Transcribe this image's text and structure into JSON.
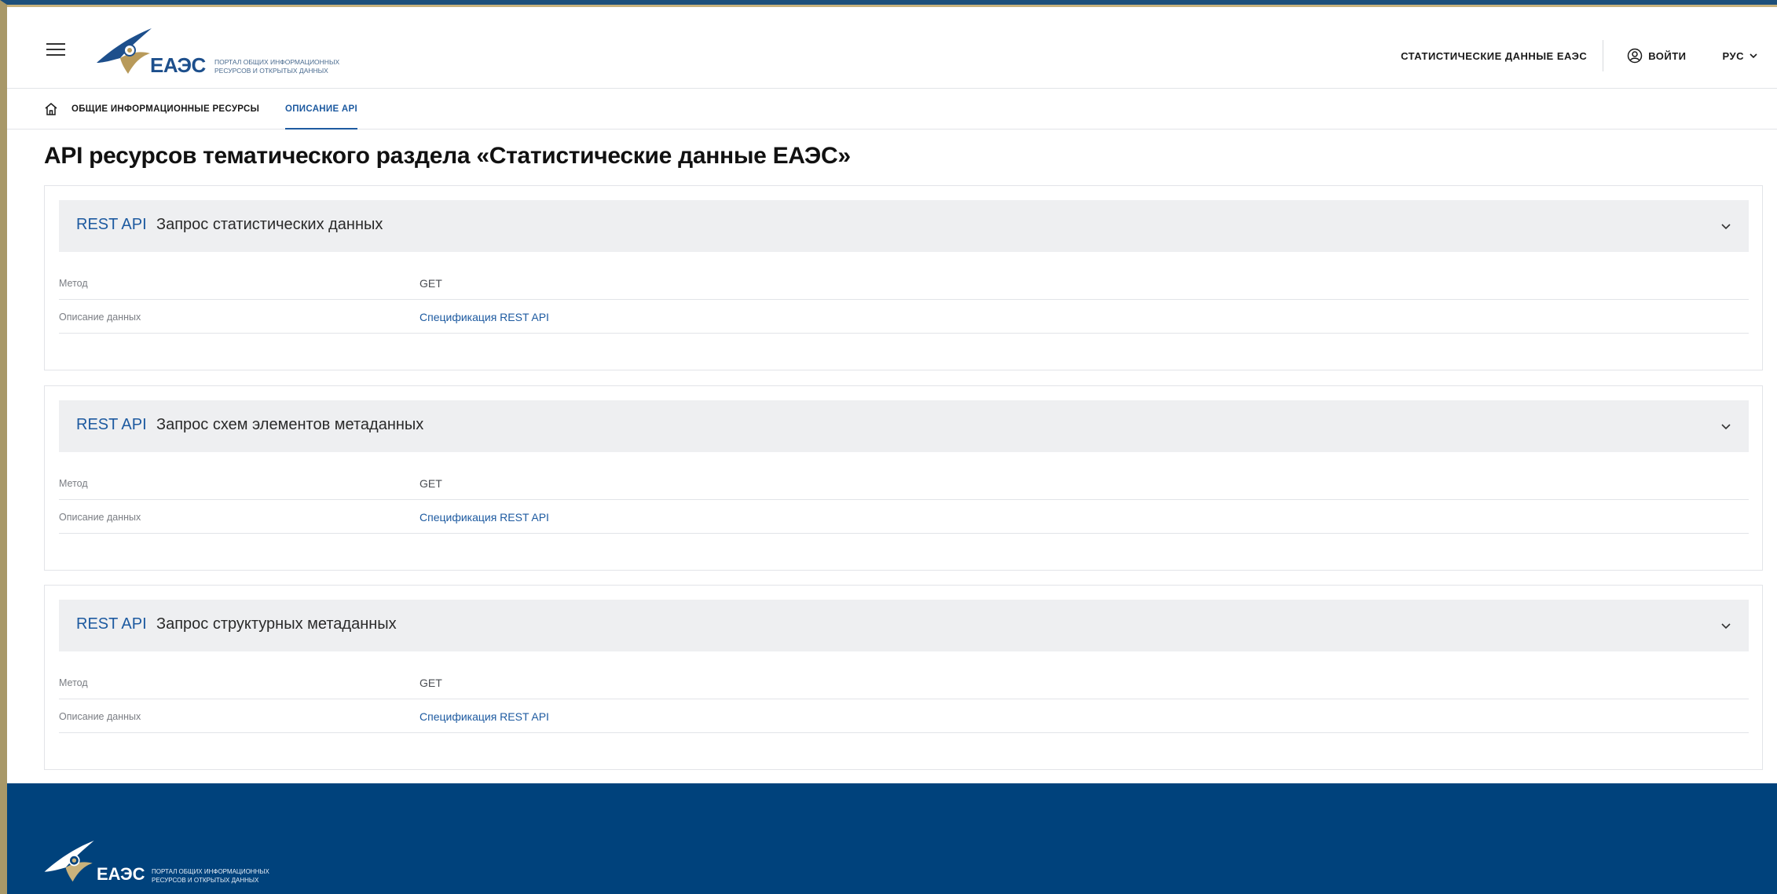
{
  "header": {
    "logo": {
      "brand": "ЕАЭС",
      "subtitle_line1": "ПОРТАЛ ОБЩИХ ИНФОРМАЦИОННЫХ",
      "subtitle_line2": "РЕСУРСОВ И ОТКРЫТЫХ ДАННЫХ"
    },
    "stats_link": "СТАТИСТИЧЕСКИЕ ДАННЫЕ ЕАЭС",
    "login_label": "ВОЙТИ",
    "language": "РУС"
  },
  "subnav": {
    "items": [
      {
        "label": "ОБЩИЕ ИНФОРМАЦИОННЫЕ РЕСУРСЫ"
      },
      {
        "label": "ОПИСАНИЕ API"
      }
    ]
  },
  "page": {
    "title": "API ресурсов тематического раздела «Статистические данные ЕАЭС»"
  },
  "cards": [
    {
      "tag": "REST API",
      "title": "Запрос статистических данных",
      "rows": [
        {
          "key": "Метод",
          "value": "GET"
        },
        {
          "key": "Описание данных",
          "value": "Спецификация REST API"
        }
      ]
    },
    {
      "tag": "REST API",
      "title": "Запрос схем элементов метаданных",
      "rows": [
        {
          "key": "Метод",
          "value": "GET"
        },
        {
          "key": "Описание данных",
          "value": "Спецификация REST API"
        }
      ]
    },
    {
      "tag": "REST API",
      "title": "Запрос структурных метаданных",
      "rows": [
        {
          "key": "Метод",
          "value": "GET"
        },
        {
          "key": "Описание данных",
          "value": "Спецификация REST API"
        }
      ]
    }
  ],
  "footer": {
    "brand": "ЕАЭС",
    "subtitle_line1": "ПОРТАЛ ОБЩИХ ИНФОРМАЦИОННЫХ",
    "subtitle_line2": "РЕСУРСОВ И ОТКРЫТЫХ ДАННЫХ"
  },
  "colors": {
    "accent": "#1d5aa0",
    "footer_bg": "#00427c",
    "card_head_bg": "#eeeff1",
    "gold": "#c9b27c"
  },
  "icons": {
    "menu": "hamburger-icon",
    "login": "user-circle-icon",
    "language_dropdown": "chevron-down-icon",
    "home": "home-icon",
    "expand": "chevron-down-icon"
  }
}
